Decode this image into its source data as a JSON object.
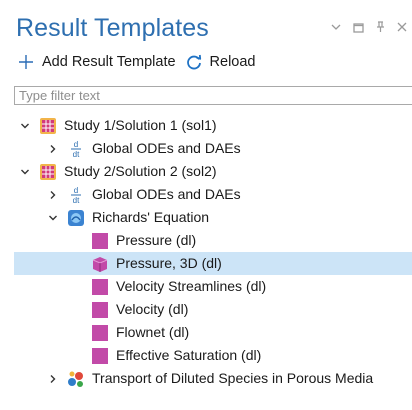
{
  "panel": {
    "title": "Result Templates"
  },
  "toolbar": {
    "add_label": "Add Result Template",
    "reload_label": "Reload"
  },
  "filter": {
    "placeholder": "Type filter text",
    "value": ""
  },
  "tree": {
    "study1": {
      "label": "Study 1/Solution 1 (sol1)",
      "children": {
        "global": {
          "label": "Global ODEs and DAEs"
        }
      }
    },
    "study2": {
      "label": "Study 2/Solution 2 (sol2)",
      "children": {
        "global": {
          "label": "Global ODEs and DAEs"
        },
        "richards": {
          "label": "Richards' Equation",
          "items": [
            {
              "label": "Pressure (dl)"
            },
            {
              "label": "Pressure, 3D (dl)",
              "selected": true
            },
            {
              "label": "Velocity Streamlines (dl)"
            },
            {
              "label": "Velocity (dl)"
            },
            {
              "label": "Flownet (dl)"
            },
            {
              "label": "Effective Saturation (dl)"
            }
          ]
        },
        "transport": {
          "label": "Transport of Diluted Species in Porous Media"
        }
      }
    }
  },
  "colors": {
    "title": "#2e6fb0",
    "selection": "#cce4f7",
    "plot_icon": "#c24aa8",
    "study_icon": "#e8a33a"
  }
}
